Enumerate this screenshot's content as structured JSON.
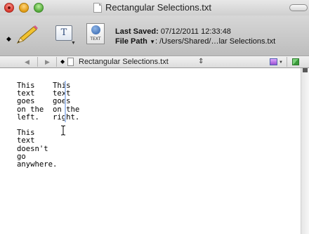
{
  "window": {
    "title": "Rectangular Selections.txt"
  },
  "toolbar": {
    "pencil_icon": "pencil-icon",
    "text_style_glyph": "T",
    "text_encoding_label": "TEXT",
    "last_saved_label": "Last Saved:",
    "last_saved_value": "07/12/2011 12:33:48",
    "file_path_label": "File Path",
    "file_path_value": ": /Users/Shared/…lar Selections.txt"
  },
  "navbar": {
    "back": "◀",
    "forward": "▶",
    "bullet": "◆",
    "file_name": "Rectangular Selections.txt",
    "updown": "⇕"
  },
  "editor": {
    "content": "This    This\ntext    text\ngoes    goes\non the  on the\nleft.   right.\n\nThis\ntext\ndoesn't\ngo\nanywhere."
  },
  "colors": {
    "selection_accent": "#a9c3ee",
    "toolbar_bg": "#c8c8c8"
  }
}
